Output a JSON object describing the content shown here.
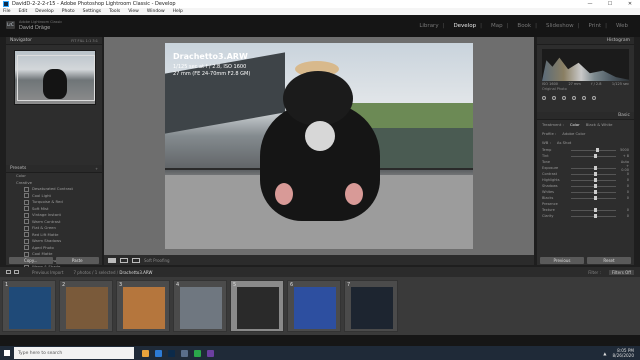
{
  "window": {
    "title": "DavidD-2-2-2-r15 - Adobe Photoshop Lightroom Classic - Develop",
    "minimize": "—",
    "maximize": "☐",
    "close": "✕"
  },
  "menu": [
    "File",
    "Edit",
    "Develop",
    "Photo",
    "Settings",
    "Tools",
    "View",
    "Window",
    "Help"
  ],
  "identity": {
    "badge": "LrC",
    "small_text": "Adobe Lightroom Classic",
    "name": "David Dräge"
  },
  "modules": [
    {
      "label": "Library",
      "active": false
    },
    {
      "label": "Develop",
      "active": true
    },
    {
      "label": "Map",
      "active": false
    },
    {
      "label": "Book",
      "active": false
    },
    {
      "label": "Slideshow",
      "active": false
    },
    {
      "label": "Print",
      "active": false
    },
    {
      "label": "Web",
      "active": false
    }
  ],
  "left_panel": {
    "navigator_title": "Navigator",
    "navigator_zoom": "FIT  FILL  1:1  3:1",
    "presets_title": "Presets",
    "presets": [
      {
        "label": "Color",
        "sub": false
      },
      {
        "label": "Creative",
        "sub": false
      },
      {
        "label": "Desaturated Contrast",
        "sub": true
      },
      {
        "label": "Cool Light",
        "sub": true
      },
      {
        "label": "Turquoise & Red",
        "sub": true
      },
      {
        "label": "Soft Mist",
        "sub": true
      },
      {
        "label": "Vintage Instant",
        "sub": true
      },
      {
        "label": "Warm Contrast",
        "sub": true
      },
      {
        "label": "Flat & Green",
        "sub": true
      },
      {
        "label": "Red Lift Matte",
        "sub": true
      },
      {
        "label": "Warm Shadows",
        "sub": true
      },
      {
        "label": "Aged Photo",
        "sub": true
      },
      {
        "label": "Cool Matte",
        "sub": true
      },
      {
        "label": "Cool Shadows & Warm Highlights",
        "sub": true
      },
      {
        "label": "Warm & Shade",
        "sub": true
      },
      {
        "label": "B&W",
        "sub": false
      }
    ],
    "copy_btn": "Copy...",
    "paste_btn": "Paste"
  },
  "photo": {
    "filename": "Drachetto3.ARW",
    "exposure": "1/125 sec at f / 2.8, ISO 1600",
    "lens": "27 mm (FE 24-70mm F2.8 GM)"
  },
  "toolbar": {
    "soft_proofing": "Soft Proofing"
  },
  "right_panel": {
    "histogram_title": "Histogram",
    "histo_vals": [
      "ISO 1600",
      "27 mm",
      "f / 2.8",
      "1/125 sec"
    ],
    "original_photo": "Original Photo",
    "basic_title": "Basic",
    "treatment_label": "Treatment :",
    "treatment_color": "Color",
    "treatment_bw": "Black & White",
    "profile_label": "Profile :",
    "profile_value": "Adobe Color",
    "wb_label": "WB :",
    "wb_value": "As Shot",
    "sliders": [
      {
        "label": "Temp",
        "value": "5000",
        "pos": 0.55
      },
      {
        "label": "Tint",
        "value": "+ 8",
        "pos": 0.52
      },
      {
        "label": "Tone",
        "value": "Auto",
        "pos": -1
      },
      {
        "label": "Exposure",
        "value": "+ 0.00",
        "pos": 0.5
      },
      {
        "label": "Contrast",
        "value": "0",
        "pos": 0.5
      },
      {
        "label": "Highlights",
        "value": "0",
        "pos": 0.5
      },
      {
        "label": "Shadows",
        "value": "0",
        "pos": 0.5
      },
      {
        "label": "Whites",
        "value": "0",
        "pos": 0.5
      },
      {
        "label": "Blacks",
        "value": "0",
        "pos": 0.5
      },
      {
        "label": "Presence",
        "value": "",
        "pos": -1
      },
      {
        "label": "Texture",
        "value": "0",
        "pos": 0.5
      },
      {
        "label": "Clarity",
        "value": "0",
        "pos": 0.5
      }
    ],
    "previous_btn": "Previous",
    "reset_btn": "Reset"
  },
  "filmstrip_bar": {
    "source": "Previous Import",
    "count": "7 photos / 1 selected / ",
    "current": "Drachetto3.ARW",
    "filter_label": "Filter :",
    "filter_value": "Filters Off"
  },
  "filmstrip": [
    {
      "num": "1",
      "color": "#1f4a78",
      "selected": false
    },
    {
      "num": "2",
      "color": "#7a5a3a",
      "selected": false
    },
    {
      "num": "3",
      "color": "#b5763d",
      "selected": false
    },
    {
      "num": "4",
      "color": "#6f7780",
      "selected": false
    },
    {
      "num": "5",
      "color": "#2a2a2a",
      "selected": true
    },
    {
      "num": "6",
      "color": "#2d4fa0",
      "selected": false
    },
    {
      "num": "7",
      "color": "#1d2530",
      "selected": false
    }
  ],
  "taskbar": {
    "search_placeholder": "Type here to search",
    "time": "8:05 PM",
    "date": "8/26/2020"
  }
}
